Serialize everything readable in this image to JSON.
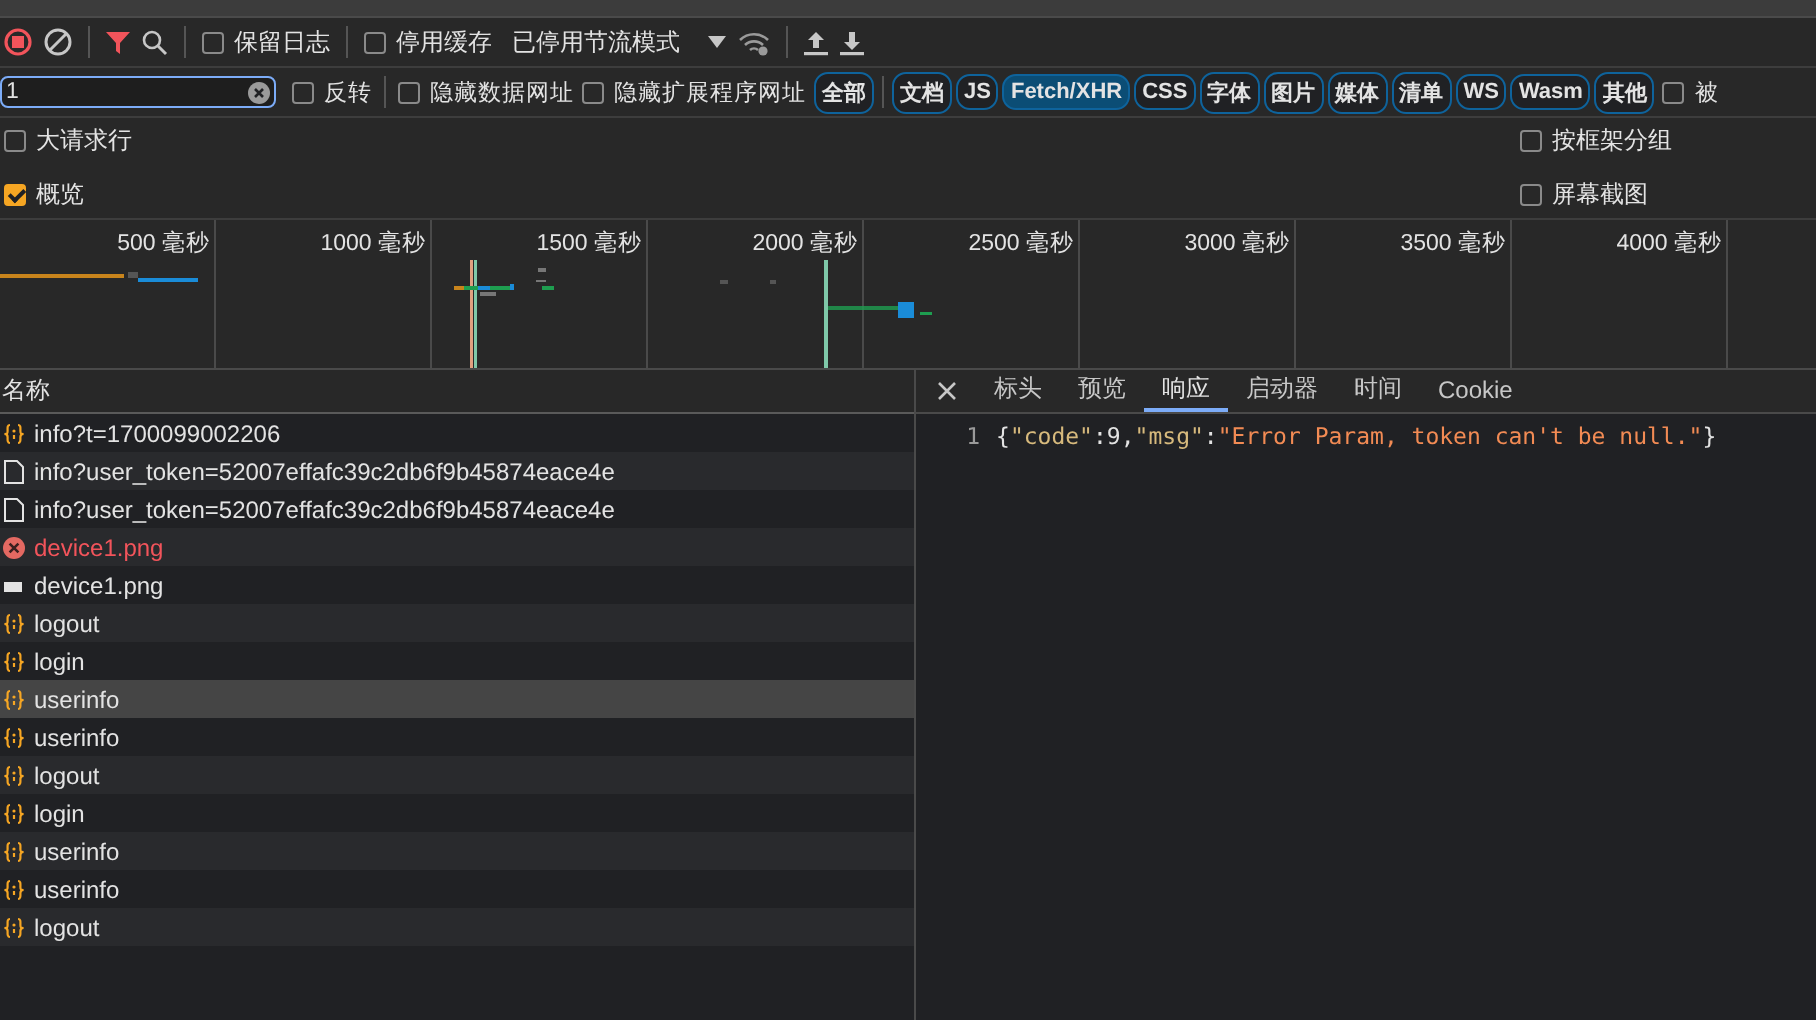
{
  "toolbar": {
    "preserve_log": {
      "label": "保留日志",
      "checked": false
    },
    "disable_cache": {
      "label": "停用缓存",
      "checked": false
    },
    "throttling": {
      "value": "已停用节流模式"
    }
  },
  "filter_bar": {
    "search": {
      "value": "1"
    },
    "invert": {
      "label": "反转",
      "checked": false
    },
    "hide_data_urls": {
      "label": "隐藏数据网址",
      "checked": false
    },
    "hide_extension_urls": {
      "label": "隐藏扩展程序网址",
      "checked": false
    },
    "types": [
      {
        "label": "全部",
        "selected": false
      },
      {
        "label": "文档",
        "selected": false
      },
      {
        "label": "JS",
        "selected": false
      },
      {
        "label": "Fetch/XHR",
        "selected": true
      },
      {
        "label": "CSS",
        "selected": false
      },
      {
        "label": "字体",
        "selected": false
      },
      {
        "label": "图片",
        "selected": false
      },
      {
        "label": "媒体",
        "selected": false
      },
      {
        "label": "清单",
        "selected": false
      },
      {
        "label": "WS",
        "selected": false
      },
      {
        "label": "Wasm",
        "selected": false
      },
      {
        "label": "其他",
        "selected": false
      }
    ],
    "extra_checkbox": {
      "label": "被",
      "checked": false
    }
  },
  "options_left": [
    {
      "label": "大请求行",
      "checked": false
    },
    {
      "label": "概览",
      "checked": true
    }
  ],
  "options_right": [
    {
      "label": "按框架分组",
      "checked": false
    },
    {
      "label": "屏幕截图",
      "checked": false
    }
  ],
  "timeline": {
    "ticks": [
      "500 毫秒",
      "1000 毫秒",
      "1500 毫秒",
      "2000 毫秒",
      "2500 毫秒",
      "3000 毫秒",
      "3500 毫秒",
      "4000 毫秒"
    ]
  },
  "requests": {
    "header": "名称",
    "rows": [
      {
        "name": "info?t=1700099002206",
        "kind": "xhr",
        "selected": false
      },
      {
        "name": "info?user_token=52007effafc39c2db6f9b45874eace4e",
        "kind": "doc",
        "selected": false
      },
      {
        "name": "info?user_token=52007effafc39c2db6f9b45874eace4e",
        "kind": "doc",
        "selected": false
      },
      {
        "name": "device1.png",
        "kind": "error",
        "selected": false
      },
      {
        "name": "device1.png",
        "kind": "image",
        "selected": false
      },
      {
        "name": "logout",
        "kind": "xhr",
        "selected": false
      },
      {
        "name": "login",
        "kind": "xhr",
        "selected": false
      },
      {
        "name": "userinfo",
        "kind": "xhr",
        "selected": true
      },
      {
        "name": "userinfo",
        "kind": "xhr",
        "selected": false
      },
      {
        "name": "logout",
        "kind": "xhr",
        "selected": false
      },
      {
        "name": "login",
        "kind": "xhr",
        "selected": false
      },
      {
        "name": "userinfo",
        "kind": "xhr",
        "selected": false
      },
      {
        "name": "userinfo",
        "kind": "xhr",
        "selected": false
      },
      {
        "name": "logout",
        "kind": "xhr",
        "selected": false
      }
    ]
  },
  "details": {
    "tabs": [
      {
        "label": "标头",
        "selected": false
      },
      {
        "label": "预览",
        "selected": false
      },
      {
        "label": "响应",
        "selected": true
      },
      {
        "label": "启动器",
        "selected": false
      },
      {
        "label": "时间",
        "selected": false
      },
      {
        "label": "Cookie",
        "selected": false
      }
    ],
    "response_lines": [
      {
        "number": "1",
        "tokens": [
          {
            "text": "{",
            "kind": "punct"
          },
          {
            "text": "\"code\"",
            "kind": "key"
          },
          {
            "text": ":",
            "kind": "punct"
          },
          {
            "text": "9",
            "kind": "number"
          },
          {
            "text": ",",
            "kind": "punct"
          },
          {
            "text": "\"msg\"",
            "kind": "key"
          },
          {
            "text": ":",
            "kind": "punct"
          },
          {
            "text": "\"Error Param, token can't be null.\"",
            "kind": "string"
          },
          {
            "text": "}",
            "kind": "punct"
          }
        ]
      }
    ]
  }
}
